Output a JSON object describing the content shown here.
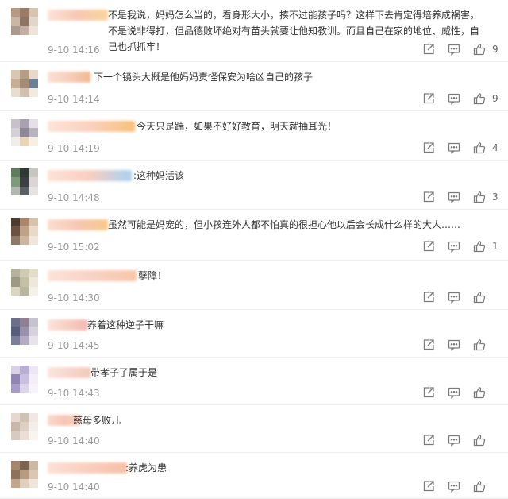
{
  "comments": [
    {
      "text": "不是我说，妈妈怎么当的，看身形大小，揍不过能孩子吗？这样下去肯定得培养成祸害，不是说非得打，但品德败坏绝对有苗头就要让他知教训。而且自己在家的地位、威性，自己也抓抓牢！",
      "time": "9-10 14:16",
      "likes": "9",
      "colors": [
        "#b79a84",
        "#9a7c66",
        "#d6c3b0",
        "#c9b6a5",
        "#8d7563",
        "#e3d6c8",
        "#a99a8c",
        "#c2b1a0",
        "#ede3d8"
      ],
      "user": "linear-gradient(90deg,#fde2d6,#f7c8b3,#f9d59a)"
    },
    {
      "text": "下一个镜头大概是他妈妈责怪保安为啥凶自己的孩子",
      "time": "9-10 14:14",
      "likes": "9",
      "colors": [
        "#d9c7b4",
        "#b79d86",
        "#e6d8ca",
        "#c7ad95",
        "#a38b78",
        "#6b7f99",
        "#e8ddd1",
        "#d1c0ae",
        "#f2e9df"
      ],
      "user": "linear-gradient(90deg,#fbe0d4,#f6cfbd,#f3b88e)"
    },
    {
      "text": "今天只是踹，如果不好好教育，明天就抽耳光！",
      "time": "9-10 14:19",
      "likes": "4",
      "colors": [
        "#c6c2c8",
        "#a8a2ae",
        "#e4e0e6",
        "#d5cfd6",
        "#8e8894",
        "#b9b3bd",
        "#f1eee9",
        "#e7d6b6",
        "#f6f0e4"
      ],
      "user": "linear-gradient(90deg,#fde4d8,#fad0be,#f7c17a)"
    },
    {
      "text": ":这种妈活该",
      "time": "9-10 14:48",
      "likes": "3",
      "colors": [
        "#5f7d5e",
        "#2f3a34",
        "#c9c5c1",
        "#7d9a7b",
        "#3b3f44",
        "#d9d6d3",
        "#b2b8b0",
        "#595f63",
        "#e6e4e2"
      ],
      "user": "linear-gradient(90deg,#fde2d6,#f7cfc0,#a9d3f2)"
    },
    {
      "text": "虽然可能是妈宠的，但小孩连外人都不怕真的很担心他以后会长成什么样的大人……",
      "time": "9-10 15:02",
      "likes": "1",
      "colors": [
        "#4d3b30",
        "#a8876d",
        "#d7c2ae",
        "#6b5241",
        "#bfa389",
        "#e8d9c9",
        "#8f7866",
        "#cbb5a1",
        "#f0e6dc"
      ],
      "user": "linear-gradient(90deg,#fcdcd0,#f7c7b4,#f7c98a)"
    },
    {
      "text": "孽障！",
      "time": "9-10 14:30",
      "likes": "",
      "colors": [
        "#b5b39d",
        "#cfcbb3",
        "#e1ddc9",
        "#9c9a85",
        "#c4c0a8",
        "#ece9dc",
        "#d9d6c4",
        "#b8b5a0",
        "#f3f1e8"
      ],
      "user": "linear-gradient(90deg,#fde3d8,#f8d2c4,#f9c6a8)"
    },
    {
      "text": "养着这种逆子干嘛",
      "time": "9-10 14:45",
      "likes": "",
      "colors": [
        "#6b6f8c",
        "#8e7f93",
        "#c8c2cf",
        "#585d7e",
        "#9a92a8",
        "#d6d1dc",
        "#7a7e99",
        "#b3acc1",
        "#e7e3ea"
      ],
      "user": "linear-gradient(90deg,#fde4da,#f7cfc3,#f2b8b1)"
    },
    {
      "text": "带孝子了属于是",
      "time": "9-10 14:43",
      "likes": "",
      "colors": [
        "#d8d2e6",
        "#b8aed2",
        "#ebe6f2",
        "#8f86b4",
        "#c9c0df",
        "#f2eff7",
        "#a79dc9",
        "#ddd6ea",
        "#f6f4fa"
      ],
      "user": "linear-gradient(90deg,#fbe6de,#f6d6cc,#f3c9bd)"
    },
    {
      "text": "慈母多败儿",
      "time": "9-10 14:40",
      "likes": "",
      "colors": [
        "#e4d8cf",
        "#d1c2b6",
        "#f0e8e1",
        "#c8b7a8",
        "#ddd0c5",
        "#f4eee8",
        "#d8cabe",
        "#e9dfd6",
        "#f8f4f0"
      ],
      "user": "linear-gradient(90deg,#fbd9cc,#f6c6b6,#f9d1c1)"
    },
    {
      "text": ":养虎为患",
      "time": "9-10 14:40",
      "likes": "",
      "colors": [
        "#a4876c",
        "#7d6450",
        "#cdb8a2",
        "#8e735c",
        "#b69b80",
        "#d9c7b4",
        "#c1a68c",
        "#e0cfbd",
        "#efe5da"
      ],
      "user": "linear-gradient(90deg,#fde0d4,#f9cfbf,#f5c0a6)"
    }
  ],
  "icons": {
    "share": "share-icon",
    "comment": "comment-icon",
    "like": "thumbs-up-icon"
  }
}
